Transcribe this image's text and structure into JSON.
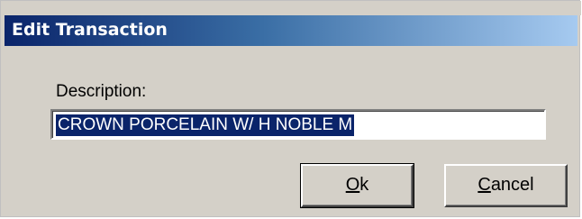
{
  "dialog": {
    "title": "Edit Transaction",
    "description_label": "Description:",
    "description_value": "CROWN PORCELAIN W/ H NOBLE M",
    "ok_accel": "O",
    "ok_rest": "k",
    "cancel_accel": "C",
    "cancel_rest": "ancel"
  },
  "colors": {
    "titlebar_start": "#0a246a",
    "titlebar_end": "#a6caf0",
    "face": "#d4d0c8",
    "selection": "#0a246a"
  }
}
